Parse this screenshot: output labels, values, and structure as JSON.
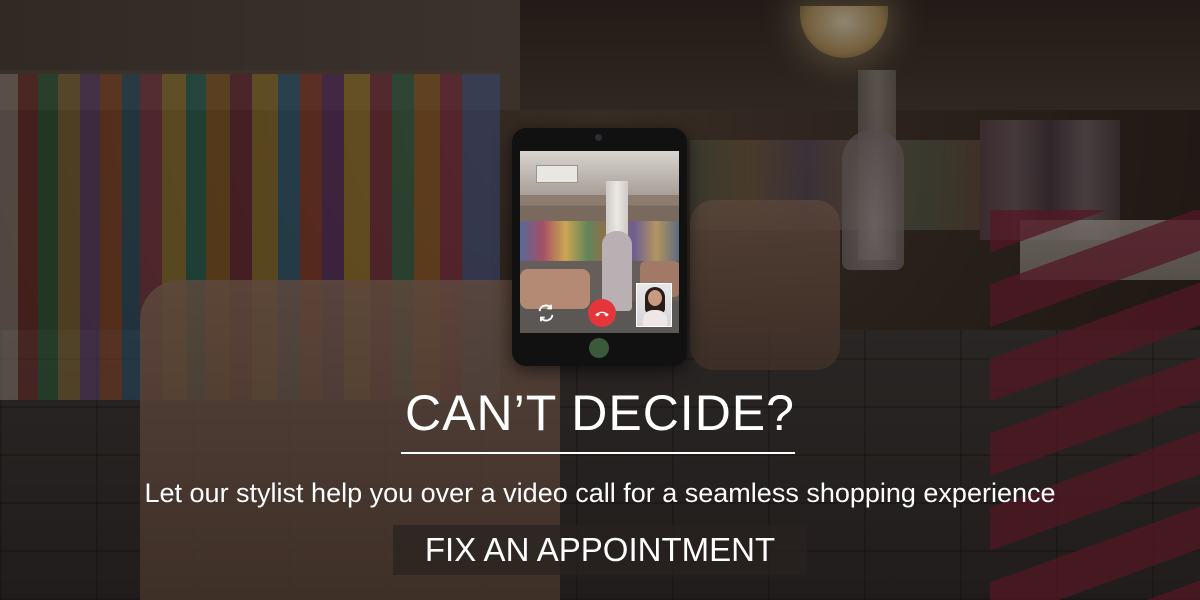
{
  "banner": {
    "headline": "CAN’T DECIDE?",
    "subheadline": "Let our stylist help you over a video call for a seamless shopping experience",
    "cta_label": "FIX AN APPOINTMENT"
  },
  "video_call": {
    "icons": [
      "switch-camera-icon",
      "end-call-icon",
      "self-view-thumbnail"
    ]
  },
  "colors": {
    "end_call": "#e4353b",
    "text": "#ffffff",
    "cta_background": "#282220"
  }
}
